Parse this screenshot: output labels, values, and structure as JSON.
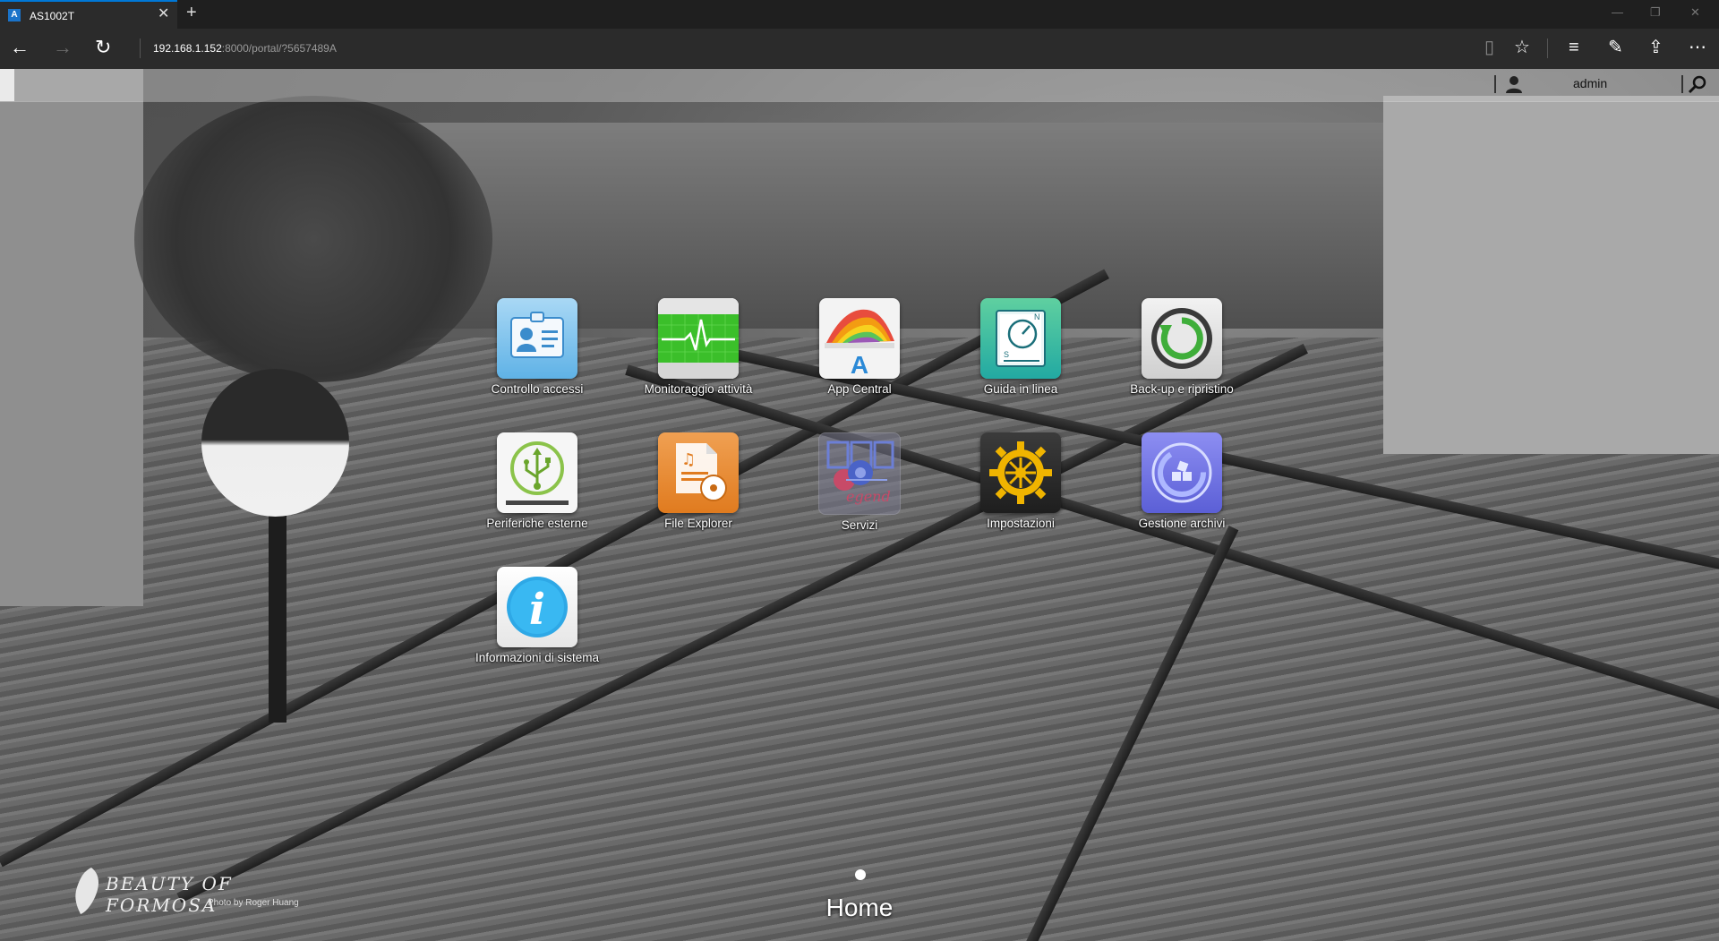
{
  "browser": {
    "tab_title": "AS1002T",
    "url_host": "192.168.1.152",
    "url_rest": ":8000/portal/?5657489A",
    "window_controls": [
      "minimize-icon",
      "restore-icon",
      "close-icon"
    ]
  },
  "portal": {
    "username": "admin"
  },
  "apps": [
    {
      "label": "Controllo accessi",
      "icon": "access-control-icon"
    },
    {
      "label": "Monitoraggio attività",
      "icon": "activity-monitor-icon"
    },
    {
      "label": "App Central",
      "icon": "app-central-icon"
    },
    {
      "label": "Guida in linea",
      "icon": "online-help-icon"
    },
    {
      "label": "Back-up e ripristino",
      "icon": "backup-restore-icon"
    },
    {
      "label": "Periferiche esterne",
      "icon": "external-devices-icon"
    },
    {
      "label": "File Explorer",
      "icon": "file-explorer-icon"
    },
    {
      "label": "Servizi",
      "icon": "services-icon"
    },
    {
      "label": "Impostazioni",
      "icon": "settings-icon"
    },
    {
      "label": "Gestione archivi",
      "icon": "storage-manager-icon"
    },
    {
      "label": "Informazioni di sistema",
      "icon": "system-info-icon"
    }
  ],
  "footer": {
    "page_title": "Home",
    "watermark_main": "BEAUTY OF FORMOSA",
    "watermark_sub": "Photo by Roger Huang"
  }
}
